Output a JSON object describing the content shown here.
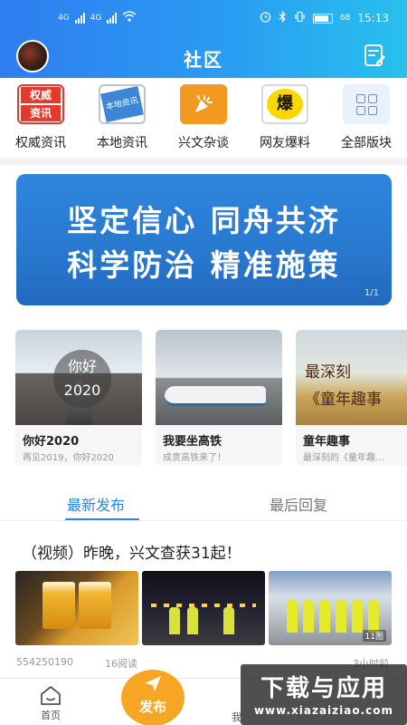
{
  "status": {
    "net1": "4G",
    "net2": "4G",
    "battery": "68",
    "time": "15:13"
  },
  "header": {
    "title": "社区"
  },
  "categories": [
    {
      "label": "权威资讯",
      "icon": "authority-news-icon",
      "icon_text_1": "权威",
      "icon_text_2": "资讯"
    },
    {
      "label": "本地资讯",
      "icon": "local-news-icon",
      "icon_text": "本地资讯"
    },
    {
      "label": "兴文杂谈",
      "icon": "chat-icon"
    },
    {
      "label": "网友爆料",
      "icon": "tipoff-icon",
      "icon_text": "爆"
    },
    {
      "label": "全部版块",
      "icon": "grid-icon"
    }
  ],
  "banner": {
    "line1": "坚定信心 同舟共济",
    "line2": "科学防治 精准施策",
    "page": "1/1"
  },
  "topics": [
    {
      "title": "你好2020",
      "subtitle": "再见2019，你好2020",
      "image_text_1": "你好",
      "image_text_2": "2020"
    },
    {
      "title": "我要坐高铁",
      "subtitle": "成贵高铁来了！"
    },
    {
      "title": "童年趣事",
      "subtitle": "最深刻的《童年趣…",
      "image_text_1": "最深刻",
      "image_text_2": "《童年趣事"
    }
  ],
  "tabs": [
    {
      "label": "最新发布",
      "active": true
    },
    {
      "label": "最后回复",
      "active": false
    }
  ],
  "post": {
    "title": "（视频）昨晚，兴文查获31起！",
    "image_count": "11图",
    "user": "554250190",
    "reads": "16阅读",
    "time": "3小时前"
  },
  "bottom_nav": {
    "home": "首页",
    "publish": "发布",
    "mine": "我"
  },
  "watermark": {
    "line1": "下载与应用",
    "line2": "www.xiazaiziao.com"
  },
  "colors": {
    "accent": "#2f86de",
    "publish": "#f6a623",
    "banner": "#2878cf"
  }
}
